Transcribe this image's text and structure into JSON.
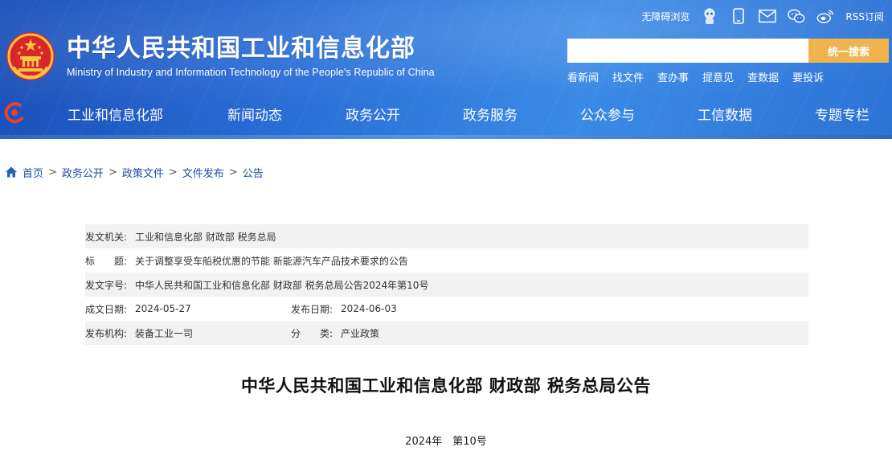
{
  "header": {
    "title": "中华人民共和国工业和信息化部",
    "subtitle": "Ministry of Industry and Information Technology of the People's Republic of China",
    "util": {
      "accessible": "无障碍浏览",
      "rss": "RSS订阅",
      "icons": [
        "robot-icon",
        "mobile-icon",
        "mail-icon",
        "wechat-icon",
        "weibo-icon"
      ]
    },
    "search": {
      "placeholder": "",
      "button": "统一搜索"
    },
    "quick_links": [
      "看新闻",
      "找文件",
      "查办事",
      "提意见",
      "查数据",
      "要投诉"
    ],
    "nav": [
      "工业和信息化部",
      "新闻动态",
      "政务公开",
      "政务服务",
      "公众参与",
      "工信数据",
      "专题专栏"
    ]
  },
  "breadcrumb": [
    "首页",
    "政务公开",
    "政策文件",
    "文件发布",
    "公告"
  ],
  "info": {
    "issuer_label": "发文机关:",
    "issuer": "工业和信息化部 财政部 税务总局",
    "title_label": "标　　题:",
    "title": "关于调整享受车船税优惠的节能 新能源汽车产品技术要求的公告",
    "doc_no_label": "发文字号:",
    "doc_no": "中华人民共和国工业和信息化部 财政部 税务总局公告2024年第10号",
    "created_label": "成文日期:",
    "created": "2024-05-27",
    "published_label": "发布日期:",
    "published": "2024-06-03",
    "org_label": "发布机构:",
    "org": "装备工业一司",
    "category_label": "分　　类:",
    "category": "产业政策"
  },
  "document": {
    "title": "中华人民共和国工业和信息化部 财政部 税务总局公告",
    "number": "2024年　第10号"
  },
  "colors": {
    "header_blue": "#2a6fd8",
    "search_button": "#f0b44f",
    "link_blue": "#1a4f9c",
    "row_shade": "#f2f2f2"
  }
}
